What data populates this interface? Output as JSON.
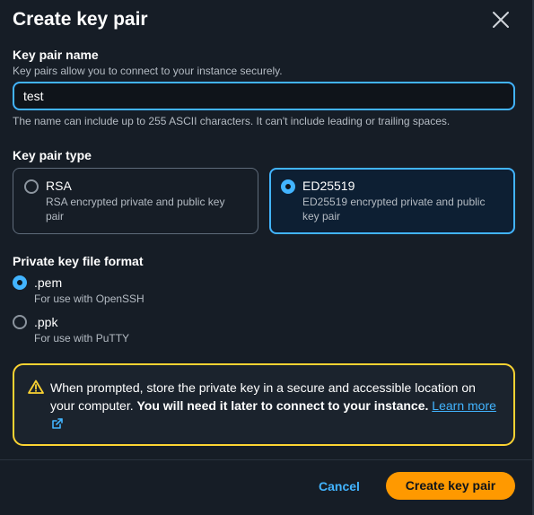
{
  "dialog": {
    "title": "Create key pair",
    "close_icon": "close-icon"
  },
  "key_name": {
    "label": "Key pair name",
    "description": "Key pairs allow you to connect to your instance securely.",
    "value": "test",
    "constraint": "The name can include up to 255 ASCII characters. It can't include leading or trailing spaces."
  },
  "key_type": {
    "label": "Key pair type",
    "options": [
      {
        "title": "RSA",
        "desc_line1": "RSA encrypted private and public key",
        "desc_line2": "pair",
        "selected": false
      },
      {
        "title": "ED25519",
        "desc_line1": "ED25519 encrypted private and public",
        "desc_line2": "key pair",
        "selected": true
      }
    ]
  },
  "file_format": {
    "label": "Private key file format",
    "options": [
      {
        "title": ".pem",
        "desc": "For use with OpenSSH",
        "selected": true
      },
      {
        "title": ".ppk",
        "desc": "For use with PuTTY",
        "selected": false
      }
    ]
  },
  "alert": {
    "icon": "warning-icon",
    "text_normal": "When prompted, store the private key in a secure and accessible location on your computer. ",
    "text_bold": "You will need it later to connect to your instance.",
    "link_text": "Learn more",
    "link_icon": "external-link-icon"
  },
  "footer": {
    "cancel_label": "Cancel",
    "create_label": "Create key pair"
  },
  "colors": {
    "accent": "#42b4ff",
    "primary_button": "#ff9900",
    "warning": "#fbd332",
    "background": "#161d26"
  }
}
